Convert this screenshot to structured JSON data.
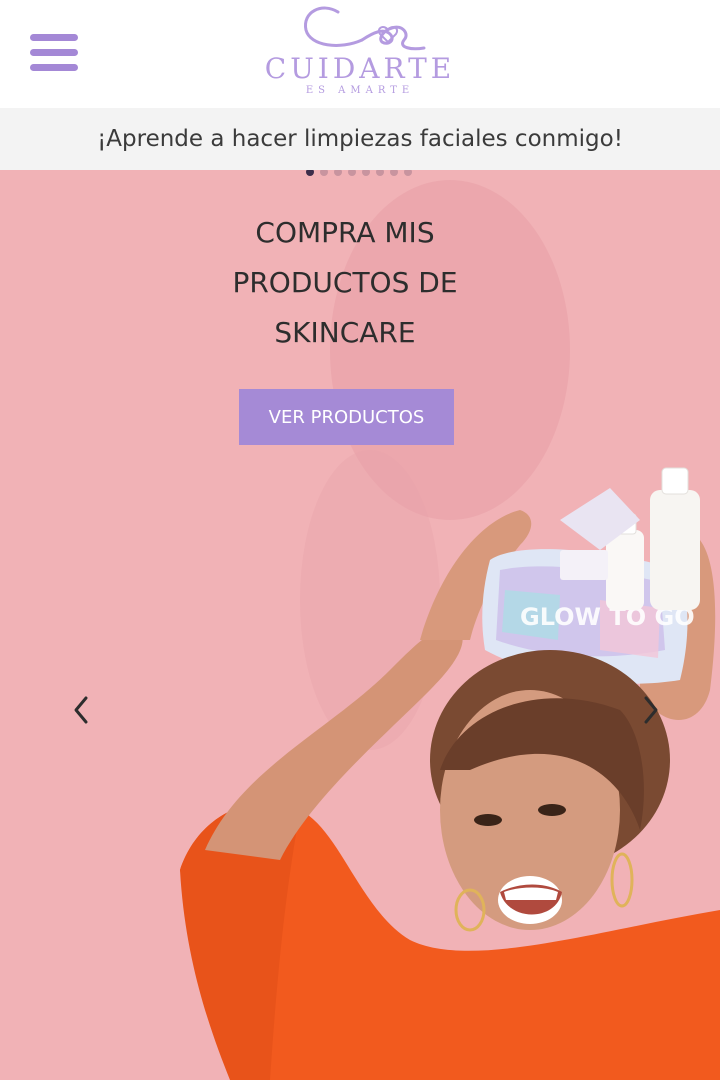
{
  "header": {
    "menu_icon": "hamburger-menu-icon",
    "logo": {
      "name": "CUIDARTE",
      "tagline": "ES AMARTE",
      "color": "#b49be0"
    }
  },
  "announcement": {
    "text": "¡Aprende a hacer limpiezas faciales conmigo!"
  },
  "hero": {
    "background_color": "#f1b2b6",
    "title_lines": [
      "COMPRA MIS",
      "PRODUCTOS DE",
      "SKINCARE"
    ],
    "cta_label": "VER PRODUCTOS",
    "cta_color": "#a58ad6",
    "carousel": {
      "active_slide": 1,
      "slide_count": 8,
      "prev_icon": "chevron-left-icon",
      "next_icon": "chevron-right-icon"
    },
    "product_pouch_text": "GLOW TO GO"
  }
}
